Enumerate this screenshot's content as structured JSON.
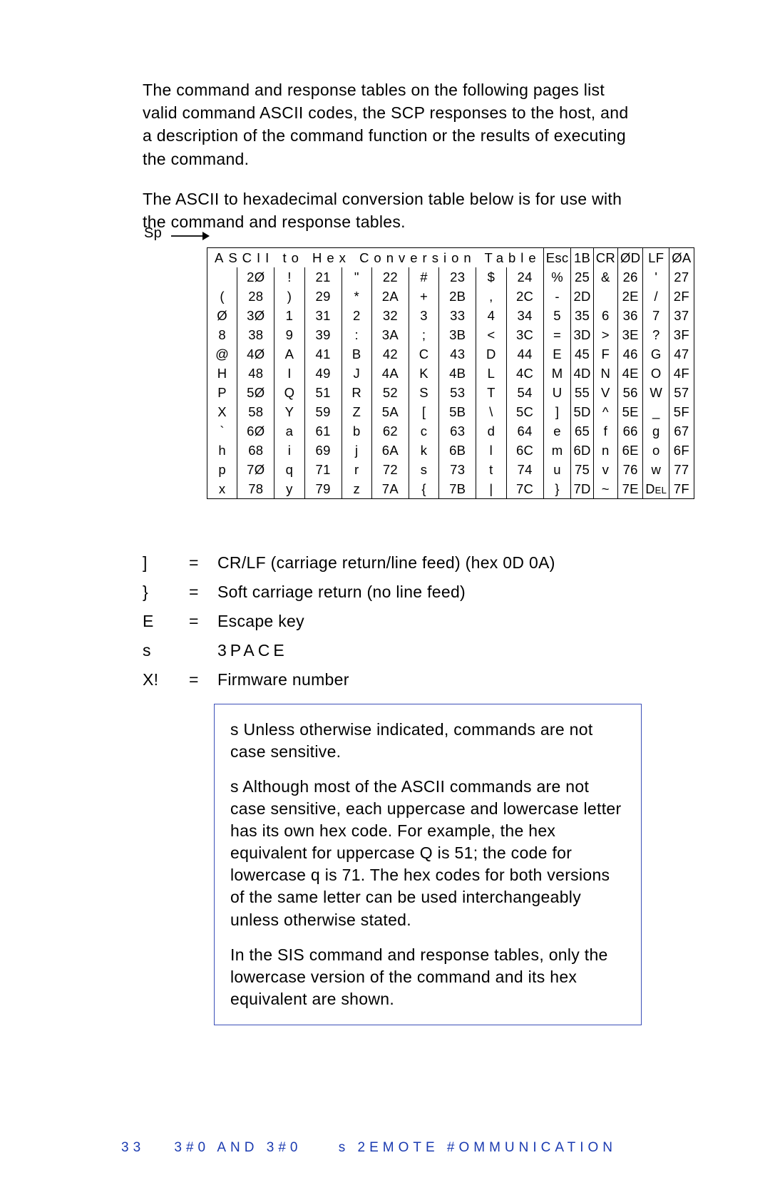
{
  "intro1": "The command and response tables on the following pages list valid command ASCII codes, the SCP responses to the host, and a description of the command function or the results of executing the command.",
  "intro2": "The ASCII to hexadecimal conversion table below is for use with the command and response tables.",
  "space_label": "Sp",
  "table_heading": "ASCII to Hex Conversion Table",
  "special_head": {
    "esc": "Esc",
    "esc_hex": "1B",
    "cr": "CR",
    "cr_hex": "ØD",
    "lf": "LF",
    "lf_hex": "ØA"
  },
  "chart_data": {
    "type": "table",
    "title": "ASCII to Hex Conversion Table",
    "note": "Each row lists 8 ASCII characters with their hexadecimal codes, covering 0x20 through 0x7F.",
    "rows": [
      [
        [
          "",
          "2Ø"
        ],
        [
          "!",
          "21"
        ],
        [
          "\"",
          "22"
        ],
        [
          "#",
          "23"
        ],
        [
          "$",
          "24"
        ],
        [
          "%",
          "25"
        ],
        [
          "&",
          "26"
        ],
        [
          "'",
          "27"
        ]
      ],
      [
        [
          "(",
          "28"
        ],
        [
          ")",
          "29"
        ],
        [
          "*",
          "2A"
        ],
        [
          "+",
          "2B"
        ],
        [
          ",",
          "2C"
        ],
        [
          "-",
          "2D"
        ],
        [
          "",
          "2E"
        ],
        [
          "/",
          "2F"
        ]
      ],
      [
        [
          "Ø",
          "3Ø"
        ],
        [
          "1",
          "31"
        ],
        [
          "2",
          "32"
        ],
        [
          "3",
          "33"
        ],
        [
          "4",
          "34"
        ],
        [
          "5",
          "35"
        ],
        [
          "6",
          "36"
        ],
        [
          "7",
          "37"
        ]
      ],
      [
        [
          "8",
          "38"
        ],
        [
          "9",
          "39"
        ],
        [
          ":",
          "3A"
        ],
        [
          ";",
          "3B"
        ],
        [
          "<",
          "3C"
        ],
        [
          "=",
          "3D"
        ],
        [
          ">",
          "3E"
        ],
        [
          "?",
          "3F"
        ]
      ],
      [
        [
          "@",
          "4Ø"
        ],
        [
          "A",
          "41"
        ],
        [
          "B",
          "42"
        ],
        [
          "C",
          "43"
        ],
        [
          "D",
          "44"
        ],
        [
          "E",
          "45"
        ],
        [
          "F",
          "46"
        ],
        [
          "G",
          "47"
        ]
      ],
      [
        [
          "H",
          "48"
        ],
        [
          "I",
          "49"
        ],
        [
          "J",
          "4A"
        ],
        [
          "K",
          "4B"
        ],
        [
          "L",
          "4C"
        ],
        [
          "M",
          "4D"
        ],
        [
          "N",
          "4E"
        ],
        [
          "O",
          "4F"
        ]
      ],
      [
        [
          "P",
          "5Ø"
        ],
        [
          "Q",
          "51"
        ],
        [
          "R",
          "52"
        ],
        [
          "S",
          "53"
        ],
        [
          "T",
          "54"
        ],
        [
          "U",
          "55"
        ],
        [
          "V",
          "56"
        ],
        [
          "W",
          "57"
        ]
      ],
      [
        [
          "X",
          "58"
        ],
        [
          "Y",
          "59"
        ],
        [
          "Z",
          "5A"
        ],
        [
          "[",
          "5B"
        ],
        [
          "\\",
          "5C"
        ],
        [
          "]",
          "5D"
        ],
        [
          "^",
          "5E"
        ],
        [
          "_",
          "5F"
        ]
      ],
      [
        [
          "`",
          "6Ø"
        ],
        [
          "a",
          "61"
        ],
        [
          "b",
          "62"
        ],
        [
          "c",
          "63"
        ],
        [
          "d",
          "64"
        ],
        [
          "e",
          "65"
        ],
        [
          "f",
          "66"
        ],
        [
          "g",
          "67"
        ]
      ],
      [
        [
          "h",
          "68"
        ],
        [
          "i",
          "69"
        ],
        [
          "j",
          "6A"
        ],
        [
          "k",
          "6B"
        ],
        [
          "l",
          "6C"
        ],
        [
          "m",
          "6D"
        ],
        [
          "n",
          "6E"
        ],
        [
          "o",
          "6F"
        ]
      ],
      [
        [
          "p",
          "7Ø"
        ],
        [
          "q",
          "71"
        ],
        [
          "r",
          "72"
        ],
        [
          "s",
          "73"
        ],
        [
          "t",
          "74"
        ],
        [
          "u",
          "75"
        ],
        [
          "v",
          "76"
        ],
        [
          "w",
          "77"
        ]
      ],
      [
        [
          "x",
          "78"
        ],
        [
          "y",
          "79"
        ],
        [
          "z",
          "7A"
        ],
        [
          "{",
          "7B"
        ],
        [
          "|",
          "7C"
        ],
        [
          "}",
          "7D"
        ],
        [
          "~",
          "7E"
        ],
        [
          "Del",
          "7F"
        ]
      ]
    ]
  },
  "definitions": [
    {
      "sym": "]",
      "eq": "=",
      "desc": "CR/LF (carriage return/line feed) (hex 0D 0A)"
    },
    {
      "sym": "}",
      "eq": "=",
      "desc": "Soft carriage return (no line feed)"
    },
    {
      "sym": "E",
      "eq": "=",
      "desc": "Escape key"
    },
    {
      "sym": "s",
      "eq": "",
      "desc": "3PACE"
    },
    {
      "sym": "X!",
      "eq": "=",
      "desc": "Firmware number"
    }
  ],
  "notes": {
    "n1": "s Unless otherwise indicated, commands are not case sensitive.",
    "n2": "s Although most of the ASCII commands are not case sensitive, each uppercase and lowercase letter has its own hex code. For example, the hex equivalent for uppercase Q is 51; the code for lowercase q is 71. The hex codes for both versions of the same letter can be used interchangeably unless otherwise stated.",
    "n3": "In the SIS command and response tables, only the lowercase version of the command and its hex equivalent are shown."
  },
  "footer": {
    "page": "33",
    "section1": "3#0    AND 3#0",
    "section2": "s 2EMOTE #OMMUNICATION"
  }
}
